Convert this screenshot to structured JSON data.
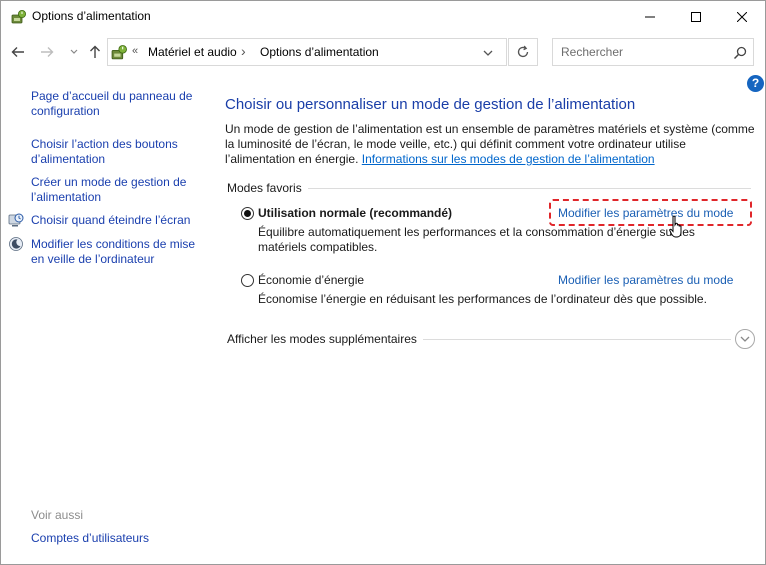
{
  "window": {
    "title": "Options d’alimentation",
    "controls": {
      "minimize": "minimize",
      "maximize": "maximize",
      "close": "close"
    }
  },
  "address_bar": {
    "overflow": "«",
    "crumbs": [
      "Matériel et audio",
      "Options d’alimentation"
    ],
    "separator": "›"
  },
  "search": {
    "placeholder": "Rechercher"
  },
  "help": {
    "label": "?"
  },
  "left_pane": {
    "links": [
      "Page d’accueil du panneau de configuration",
      "Choisir l’action des boutons d’alimentation",
      "Créer un mode de gestion de l’alimentation",
      "Choisir quand éteindre l’écran",
      "Modifier les conditions de mise en veille de l’ordinateur"
    ],
    "see_also_label": "Voir aussi",
    "see_also_links": [
      "Comptes d’utilisateurs"
    ]
  },
  "main": {
    "title": "Choisir ou personnaliser un mode de gestion de l’alimentation",
    "description": "Un mode de gestion de l’alimentation est un ensemble de paramètres matériels et système (comme la luminosité de l’écran, le mode veille, etc.) qui définit comment votre ordinateur utilise l’alimentation en énergie. ",
    "description_link": "Informations sur les modes de gestion de l’alimentation",
    "favorites_label": "Modes favoris",
    "plans": [
      {
        "name": "Utilisation normale (recommandé)",
        "selected": true,
        "description": "Équilibre automatiquement les performances et la consommation d’énergie sur les matériels compatibles.",
        "link": "Modifier les paramètres du mode"
      },
      {
        "name": "Économie d’énergie",
        "selected": false,
        "description": "Économise l’énergie en réduisant les performances de l’ordinateur dès que possible.",
        "link": "Modifier les paramètres du mode"
      }
    ],
    "more_plans_label": "Afficher les modes supplémentaires"
  },
  "icons": {
    "app": "power-options-icon",
    "back": "arrow-left-icon",
    "forward": "arrow-right-icon",
    "recent": "chevron-down-icon",
    "up": "arrow-up-icon",
    "refresh": "refresh-icon",
    "search": "search-icon",
    "expand": "chevron-down-icon"
  },
  "colors": {
    "link": "#1a3fae",
    "title": "#1a3ea8",
    "highlight": "#e0262a",
    "help": "#1565c0"
  }
}
